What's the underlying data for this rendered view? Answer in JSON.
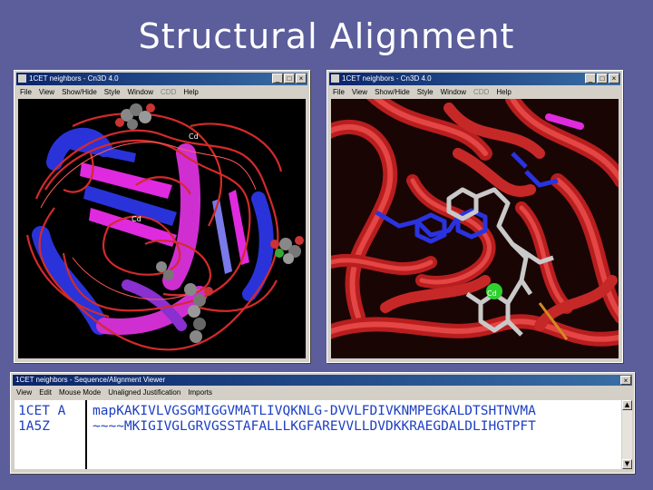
{
  "slide": {
    "title": "Structural Alignment"
  },
  "left_window": {
    "title": "1CET neighbors - Cn3D 4.0",
    "menu": [
      "File",
      "View",
      "Show/Hide",
      "Style",
      "Window",
      "CDD",
      "Help"
    ],
    "labels": {
      "cd_top": "Cd",
      "cd_mid": "Cd"
    }
  },
  "right_window": {
    "title": "1CET neighbors - Cn3D 4.0",
    "menu": [
      "File",
      "View",
      "Show/Hide",
      "Style",
      "Window",
      "CDD",
      "Help"
    ],
    "labels": {
      "cd": "Cd"
    }
  },
  "seq_window": {
    "title": "1CET neighbors - Sequence/Alignment Viewer",
    "menu": [
      "View",
      "Edit",
      "Mouse Mode",
      "Unaligned Justification",
      "Imports"
    ],
    "rows": [
      {
        "name": "1CET A",
        "seq": "mapKAKIVLVGSGMIGGVMATLIVQKNLG-DVVLFDIVKNMPEGKALDTSHTNVMA"
      },
      {
        "name": "1A5Z",
        "seq": "~~~~MKIGIVGLGRVGSSTAFALLLKGFAREVVLLDVDKKRAEGDALDLIHGTPFT"
      }
    ]
  },
  "colors": {
    "slide_bg": "#5b5e9a",
    "ribbon_red": "#d42a2a",
    "helix_blue": "#2a33d9",
    "strand_magenta": "#e02adf",
    "sequence_blue": "#1d3fc4"
  }
}
